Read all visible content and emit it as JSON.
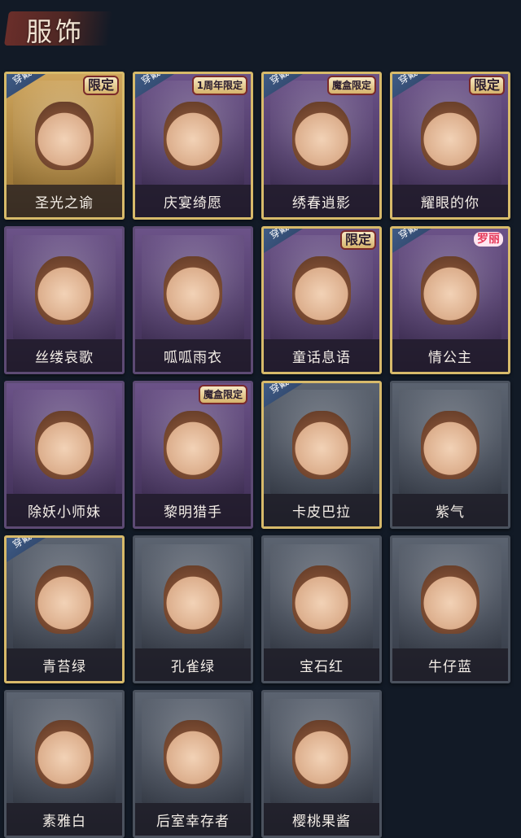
{
  "header": {
    "title": "服饰"
  },
  "cards": [
    {
      "name": "圣光之谕",
      "theme": "gold",
      "equipped": true,
      "tag": "限定"
    },
    {
      "name": "庆宴绮愿",
      "theme": "purple",
      "equipped": true,
      "tag": "1周年限定"
    },
    {
      "name": "绣春逍影",
      "theme": "purple",
      "equipped": true,
      "tag": "魔盒限定"
    },
    {
      "name": "耀眼的你",
      "theme": "purple",
      "equipped": true,
      "tag": "限定"
    },
    {
      "name": "丝缕哀歌",
      "theme": "purple",
      "equipped": false,
      "tag": ""
    },
    {
      "name": "呱呱雨衣",
      "theme": "purple",
      "equipped": false,
      "tag": ""
    },
    {
      "name": "童话息语",
      "theme": "purple",
      "equipped": true,
      "tag": "限定"
    },
    {
      "name": "情公主",
      "theme": "purple",
      "equipped": true,
      "tag": "罗丽"
    },
    {
      "name": "除妖小师妹",
      "theme": "purple",
      "equipped": false,
      "tag": ""
    },
    {
      "name": "黎明猎手",
      "theme": "purple",
      "equipped": false,
      "tag": "魔盒限定"
    },
    {
      "name": "卡皮巴拉",
      "theme": "gray",
      "equipped": true,
      "tag": ""
    },
    {
      "name": "紫气",
      "theme": "gray",
      "equipped": false,
      "tag": ""
    },
    {
      "name": "青苔绿",
      "theme": "gray",
      "equipped": true,
      "tag": ""
    },
    {
      "name": "孔雀绿",
      "theme": "gray",
      "equipped": false,
      "tag": ""
    },
    {
      "name": "宝石红",
      "theme": "gray",
      "equipped": false,
      "tag": ""
    },
    {
      "name": "牛仔蓝",
      "theme": "gray",
      "equipped": false,
      "tag": ""
    },
    {
      "name": "素雅白",
      "theme": "gray",
      "equipped": false,
      "tag": ""
    },
    {
      "name": "后室幸存者",
      "theme": "gray",
      "equipped": false,
      "tag": ""
    },
    {
      "name": "樱桃果酱",
      "theme": "gray",
      "equipped": false,
      "tag": ""
    }
  ],
  "labels": {
    "equipped": "穿戴"
  }
}
